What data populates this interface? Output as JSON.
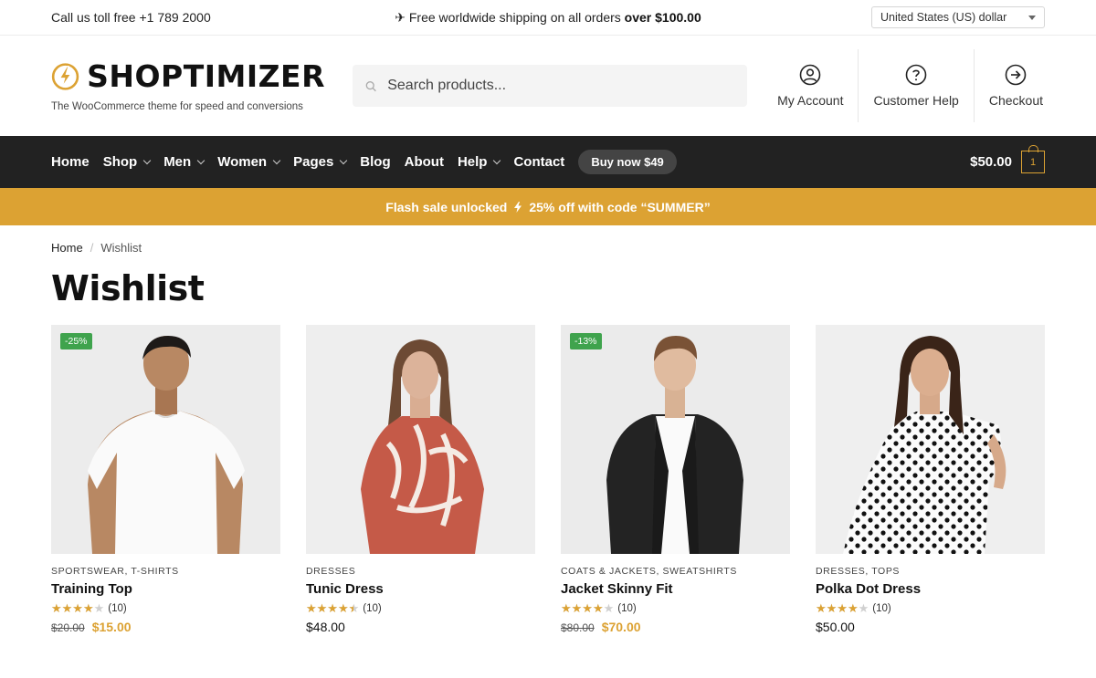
{
  "topbar": {
    "phone": "Call us toll free +1 789 2000",
    "shipping_prefix": "✈ Free worldwide shipping on all orders ",
    "shipping_bold": "over $100.00",
    "currency": "United States (US) dollar"
  },
  "header": {
    "logo_text": "SHOPTIMIZER",
    "tagline": "The WooCommerce theme for speed and conversions",
    "search_placeholder": "Search products...",
    "links": [
      {
        "label": "My Account",
        "icon": "user-icon"
      },
      {
        "label": "Customer Help",
        "icon": "help-icon"
      },
      {
        "label": "Checkout",
        "icon": "arrow-right-circle-icon"
      }
    ]
  },
  "nav": {
    "items": [
      {
        "label": "Home",
        "dropdown": false
      },
      {
        "label": "Shop",
        "dropdown": true
      },
      {
        "label": "Men",
        "dropdown": true
      },
      {
        "label": "Women",
        "dropdown": true
      },
      {
        "label": "Pages",
        "dropdown": true
      },
      {
        "label": "Blog",
        "dropdown": false
      },
      {
        "label": "About",
        "dropdown": false
      },
      {
        "label": "Help",
        "dropdown": true
      },
      {
        "label": "Contact",
        "dropdown": false
      }
    ],
    "buy_button": "Buy now $49",
    "cart_total": "$50.00",
    "cart_count": "1"
  },
  "flash": {
    "text_a": "Flash sale unlocked",
    "text_b": "25% off with code “SUMMER”"
  },
  "breadcrumb": {
    "home": "Home",
    "current": "Wishlist"
  },
  "page_title": "Wishlist",
  "products": [
    {
      "badge": "-25%",
      "categories": "SPORTSWEAR, T-SHIRTS",
      "name": "Training Top",
      "rating": 4,
      "reviews": "(10)",
      "old_price": "$20.00",
      "price": "$15.00"
    },
    {
      "badge": "",
      "categories": "DRESSES",
      "name": "Tunic Dress",
      "rating": 4.5,
      "reviews": "(10)",
      "old_price": "",
      "price": "$48.00"
    },
    {
      "badge": "-13%",
      "categories": "COATS & JACKETS, SWEATSHIRTS",
      "name": "Jacket Skinny Fit",
      "rating": 4,
      "reviews": "(10)",
      "old_price": "$80.00",
      "price": "$70.00"
    },
    {
      "badge": "",
      "categories": "DRESSES, TOPS",
      "name": "Polka Dot Dress",
      "rating": 4,
      "reviews": "(10)",
      "old_price": "",
      "price": "$50.00"
    }
  ],
  "colors": {
    "accent": "#dca233",
    "nav_bg": "#222222",
    "sale_badge": "#3fa34d"
  }
}
